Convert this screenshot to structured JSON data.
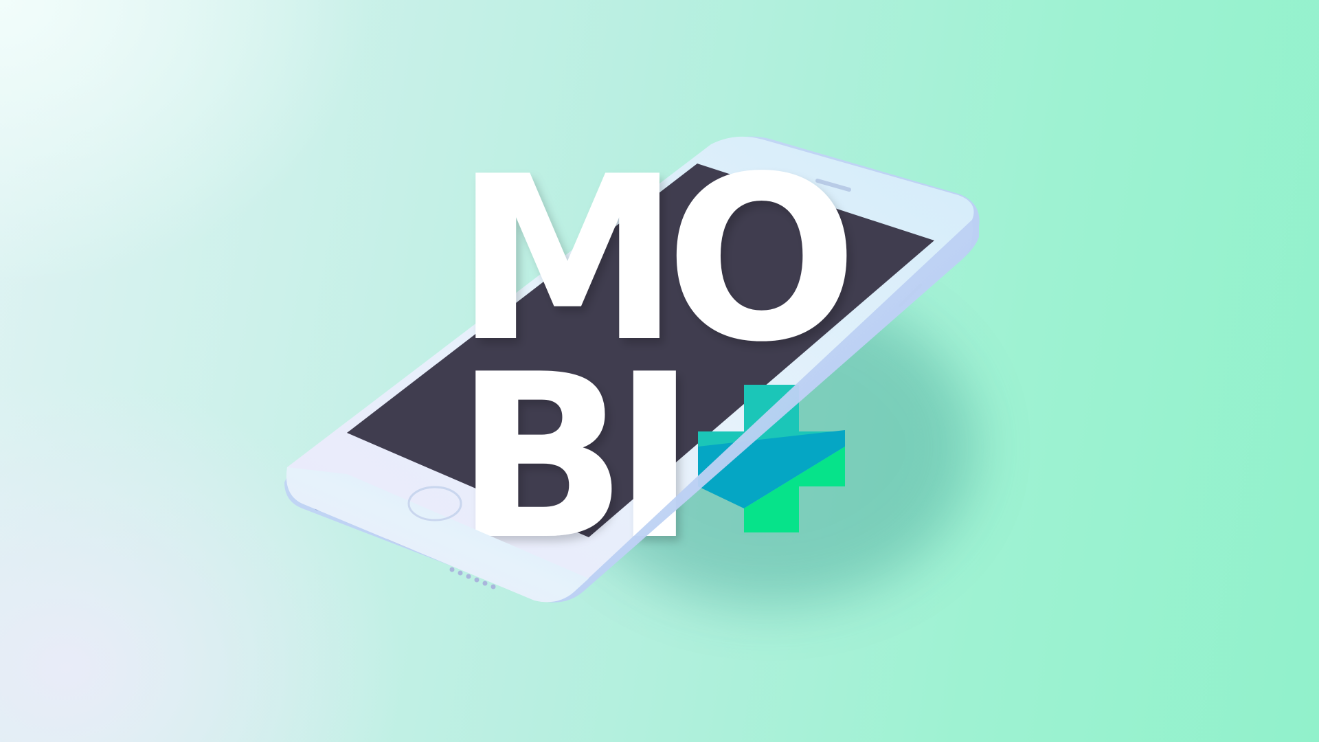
{
  "logo": {
    "line1": "MO",
    "line2": "BI",
    "plus_symbol": "+"
  },
  "colors": {
    "screen": "#403d4f",
    "logo_letters": "#ffffff",
    "plus_teal": "#1bc6b8",
    "plus_blue": "#05a6c4",
    "plus_green": "#06e38a",
    "phone_body": "#e4f0fb"
  },
  "icons": [
    "phone-mockup-icon",
    "home-button-icon",
    "plus-logo-icon"
  ]
}
